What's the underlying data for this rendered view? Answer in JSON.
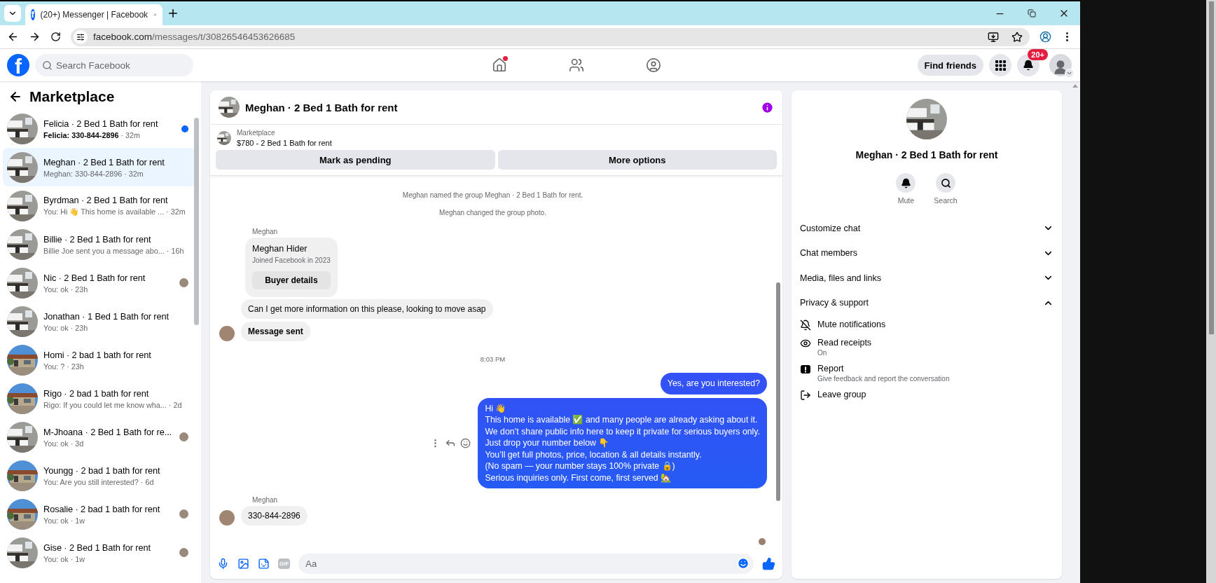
{
  "browser": {
    "tab_title": "(20+) Messenger | Facebook",
    "favicon": "f",
    "url_host": "facebook.com",
    "url_path": "/messages/t/30826546453626685"
  },
  "header": {
    "logo": "f",
    "search_placeholder": "Search Facebook",
    "nav": [
      {
        "kind": "home",
        "dot": true
      },
      {
        "kind": "friends",
        "dot": false
      },
      {
        "kind": "groups",
        "dot": false
      }
    ],
    "find_friends": "Find friends",
    "notification_badge": "20+"
  },
  "sidebar": {
    "title": "Marketplace",
    "conversations": [
      {
        "name": "Felicia · 2 Bed 1 Bath for rent",
        "preview": "Felicia: 330-844-2896",
        "time": "· 32m",
        "selected": false,
        "unread": true,
        "seen": false
      },
      {
        "name": "Meghan · 2 Bed 1 Bath for rent",
        "preview": "Meghan: 330-844-2896",
        "time": "· 32m",
        "selected": true,
        "unread": false,
        "seen": false
      },
      {
        "name": "Byrdman · 2 Bed 1 Bath for rent",
        "preview": "You: Hi 👋 This home is available ...",
        "time": "· 32m",
        "selected": false,
        "unread": false,
        "seen": false
      },
      {
        "name": "Billie · 2 Bed 1 Bath for rent",
        "preview": "Billie Joe sent you a message abo...",
        "time": "· 16h",
        "selected": false,
        "unread": false,
        "seen": false
      },
      {
        "name": "Nic · 2 Bed 1 Bath for rent",
        "preview": "You: ok",
        "time": "· 23h",
        "selected": false,
        "unread": false,
        "seen": true
      },
      {
        "name": "Jonathan · 1 Bed 1 Bath for rent",
        "preview": "You: ok",
        "time": "· 23h",
        "selected": false,
        "unread": false,
        "seen": false
      },
      {
        "name": "Homi · 2 bad 1 bath for rent",
        "preview": "You: ?",
        "time": "· 23h",
        "selected": false,
        "unread": false,
        "seen": false
      },
      {
        "name": "Rigo · 2 bad 1 bath for rent",
        "preview": "Rigo: If you could let me know wha...",
        "time": "· 2d",
        "selected": false,
        "unread": false,
        "seen": false
      },
      {
        "name": "M-Jhoana · 2 Bed 1 Bath for re...",
        "preview": "You: ok",
        "time": "· 3d",
        "selected": false,
        "unread": false,
        "seen": true
      },
      {
        "name": "Youngg · 2 bad 1 bath for rent",
        "preview": "You: Are you still interested?",
        "time": "· 6d",
        "selected": false,
        "unread": false,
        "seen": false
      },
      {
        "name": "Rosalie · 2 bad 1 bath for rent",
        "preview": "You: ok",
        "time": "· 1w",
        "selected": false,
        "unread": false,
        "seen": true
      },
      {
        "name": "Gise · 2 Bed 1 Bath for rent",
        "preview": "You: ok",
        "time": "· 1w",
        "selected": false,
        "unread": false,
        "seen": true
      }
    ]
  },
  "chat": {
    "title": "Meghan · 2 Bed 1 Bath for rent",
    "listing": {
      "source": "Marketplace",
      "title": "$780 - 2 Bed 1 Bath for rent"
    },
    "actions": [
      "Mark as pending",
      "More options"
    ],
    "messages": [
      {
        "kind": "event",
        "text": "Meghan named the group Meghan · 2 Bed 1 Bath for rent."
      },
      {
        "kind": "event",
        "text": "Meghan changed the group photo."
      },
      {
        "kind": "sender",
        "text": "Meghan"
      },
      {
        "kind": "card",
        "name": "Meghan Hider",
        "subtitle": "Joined Facebook in 2023",
        "button": "Buyer details"
      },
      {
        "kind": "incoming",
        "text": "Can I get more information on this please, looking to move asap",
        "bold": false,
        "avatar": false
      },
      {
        "kind": "incoming",
        "text": "Message sent",
        "bold": true,
        "avatar": true
      },
      {
        "kind": "time",
        "text": "8:03 PM"
      },
      {
        "kind": "outgoing",
        "lines": [
          "Yes, are you interested?"
        ],
        "actions": false
      },
      {
        "kind": "outgoing",
        "lines": [
          "Hi 👋",
          "This home is available ✅ and many people are already asking about it.",
          "We don’t share public info here to keep it private for serious buyers only.",
          "Just drop your number below 👇",
          "You’ll get full photos, price, location & all details instantly.",
          "(No spam — your number stays 100% private 🔒)",
          "Serious inquiries only. First come, first served 🏡"
        ],
        "actions": true
      },
      {
        "kind": "sender",
        "text": "Meghan"
      },
      {
        "kind": "incoming",
        "text": "330-844-2896",
        "bold": false,
        "avatar": true
      },
      {
        "kind": "seen"
      }
    ],
    "composer": {
      "gif": "GIF",
      "placeholder": "Aa"
    }
  },
  "details": {
    "title": "Meghan · 2 Bed 1 Bath for rent",
    "actions": [
      {
        "kind": "mute",
        "label": "Mute"
      },
      {
        "kind": "search",
        "label": "Search"
      }
    ],
    "sections": [
      {
        "label": "Customize chat",
        "expanded": false
      },
      {
        "label": "Chat members",
        "expanded": false
      },
      {
        "label": "Media, files and links",
        "expanded": false
      },
      {
        "label": "Privacy & support",
        "expanded": true,
        "items": [
          {
            "kind": "mute",
            "label": "Mute notifications"
          },
          {
            "kind": "receipts",
            "label": "Read receipts",
            "detail": "On"
          },
          {
            "kind": "report",
            "label": "Report",
            "detail": "Give feedback and report the conversation"
          },
          {
            "kind": "leave",
            "label": "Leave group"
          }
        ]
      }
    ]
  }
}
